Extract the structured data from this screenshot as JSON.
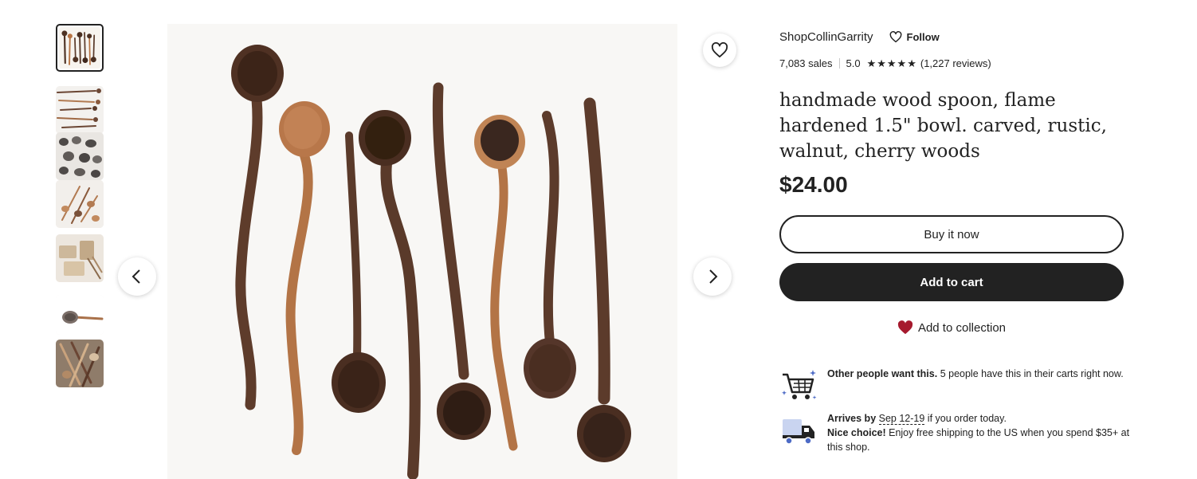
{
  "gallery": {
    "thumbnails": [
      {
        "label": "thumbnail-1",
        "active": true
      },
      {
        "label": "thumbnail-2",
        "active": false
      },
      {
        "label": "thumbnail-3",
        "active": false
      },
      {
        "label": "thumbnail-4",
        "active": false
      },
      {
        "label": "thumbnail-5",
        "active": false
      },
      {
        "label": "thumbnail-6",
        "active": false
      },
      {
        "label": "thumbnail-7",
        "active": false
      }
    ],
    "prev_icon": "chevron-left-icon",
    "next_icon": "chevron-right-icon",
    "favorite_icon": "heart-outline-icon"
  },
  "shop": {
    "name": "ShopCollinGarrity",
    "follow_label": "Follow",
    "sales": "7,083 sales",
    "rating": "5.0",
    "star_count": 5,
    "reviews": "(1,227 reviews)"
  },
  "listing": {
    "title": "handmade wood spoon, flame hardened 1.5\" bowl. carved, rustic, walnut, cherry woods",
    "price": "$24.00"
  },
  "actions": {
    "buy_now": "Buy it now",
    "add_to_cart": "Add to cart",
    "add_to_collection": "Add to collection"
  },
  "notices": {
    "demand_bold": "Other people want this.",
    "demand_rest": " 5 people have this in their carts right now.",
    "arrives_prefix": "Arrives by ",
    "arrives_date": "Sep 12-19",
    "arrives_suffix": " if you order today.",
    "shipping_bold": "Nice choice!",
    "shipping_rest": " Enjoy free shipping to the US when you spend $35+ at this shop."
  },
  "colors": {
    "text": "#222222",
    "heart_red": "#a61a2e",
    "truck_blue": "#4d6bc6",
    "walnut": "#5a3a2a",
    "cherry": "#b97a4c"
  }
}
